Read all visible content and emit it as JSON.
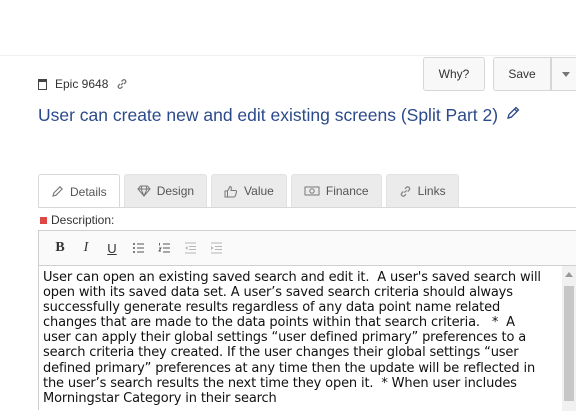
{
  "header": {
    "why_label": "Why?",
    "save_label": "Save"
  },
  "breadcrumb": {
    "label": "Epic 9648"
  },
  "page": {
    "title": "User can create new and edit existing screens (Split Part 2)",
    "title_color": "#2b4a8b"
  },
  "tabs": [
    {
      "label": "Details",
      "icon": "pencil-icon",
      "active": true
    },
    {
      "label": "Design",
      "icon": "diamond-icon",
      "active": false
    },
    {
      "label": "Value",
      "icon": "thumbs-up-icon",
      "active": false
    },
    {
      "label": "Finance",
      "icon": "money-icon",
      "active": false
    },
    {
      "label": "Links",
      "icon": "link-icon",
      "active": false
    }
  ],
  "description": {
    "label": "Description:",
    "required_color": "#e04848",
    "toolbar": [
      "B",
      "I",
      "U",
      "bulleted-list-icon",
      "numbered-list-icon",
      "outdent-icon",
      "indent-icon"
    ],
    "text": "User can open an existing saved search and edit it.  A user's saved search will open with its saved data set. A user’s saved search criteria should always successfully generate results regardless of any data point name related changes that are made to the data points within that search criteria.   *  A user can apply their global settings “user defined primary” preferences to a search criteria they created. If the user changes their global settings “user defined primary” preferences at any time then the update will be reflected in the user’s search results the next time they open it.  * When user includes Morningstar Category in their search"
  }
}
